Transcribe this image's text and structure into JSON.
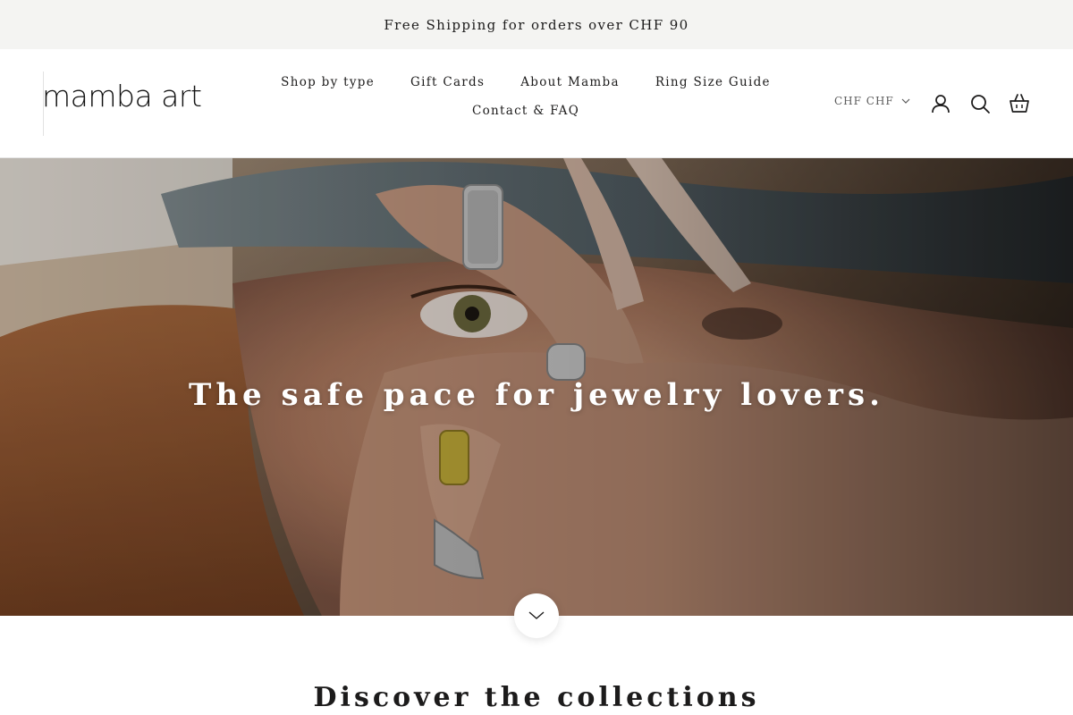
{
  "announcement": {
    "text": "Free Shipping for orders over CHF 90"
  },
  "header": {
    "logo_text": "mamba art",
    "nav": {
      "row1": [
        "Shop by type",
        "Gift Cards",
        "About Mamba",
        "Ring Size Guide"
      ],
      "row2": [
        "Contact & FAQ"
      ]
    },
    "currency": {
      "label": "CHF CHF",
      "icon": "chevron-down-icon"
    },
    "icons": [
      "account-icon",
      "search-icon",
      "cart-icon"
    ]
  },
  "hero": {
    "title": "The safe pace for jewelry lovers.",
    "image": "photo of a woman framing her eye with ringed fingers",
    "scroll_icon": "chevron-down-icon"
  },
  "collections": {
    "title": "Discover the collections"
  },
  "colors": {
    "text": "#1c1b1b",
    "announcement_bg": "#f4f4f2",
    "white": "#ffffff"
  }
}
